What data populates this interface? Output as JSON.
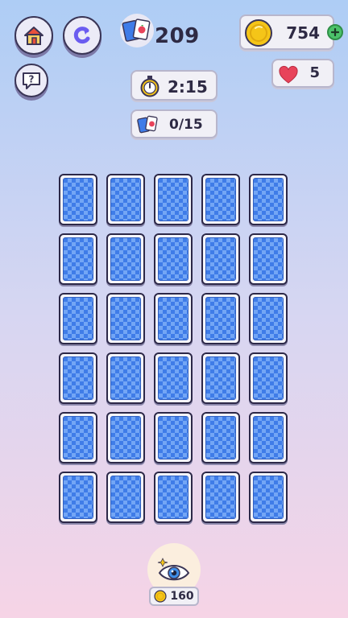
{
  "colors": {
    "card_back": "#3f7ce8",
    "coin": "#f5c518",
    "heart": "#e8435a",
    "home_roof": "#e8503c",
    "undo": "#6b5cf0"
  },
  "top_left": {
    "home_icon": "home-icon",
    "restart_icon": "restart-icon",
    "help_icon": "help-icon"
  },
  "score": {
    "value": "209",
    "icon": "cards-icon"
  },
  "coins": {
    "value": "754",
    "icon": "coin-icon",
    "add_icon": "plus-icon"
  },
  "lives": {
    "value": "5",
    "icon": "heart-icon"
  },
  "timer": {
    "value": "2:15",
    "icon": "stopwatch-icon"
  },
  "pairs": {
    "value": "0/15",
    "icon": "cards-icon"
  },
  "board": {
    "rows": 6,
    "cols": 5,
    "state": "face-down"
  },
  "reveal_powerup": {
    "icon": "eye-icon",
    "cost": "160",
    "cost_icon": "coin-icon"
  }
}
